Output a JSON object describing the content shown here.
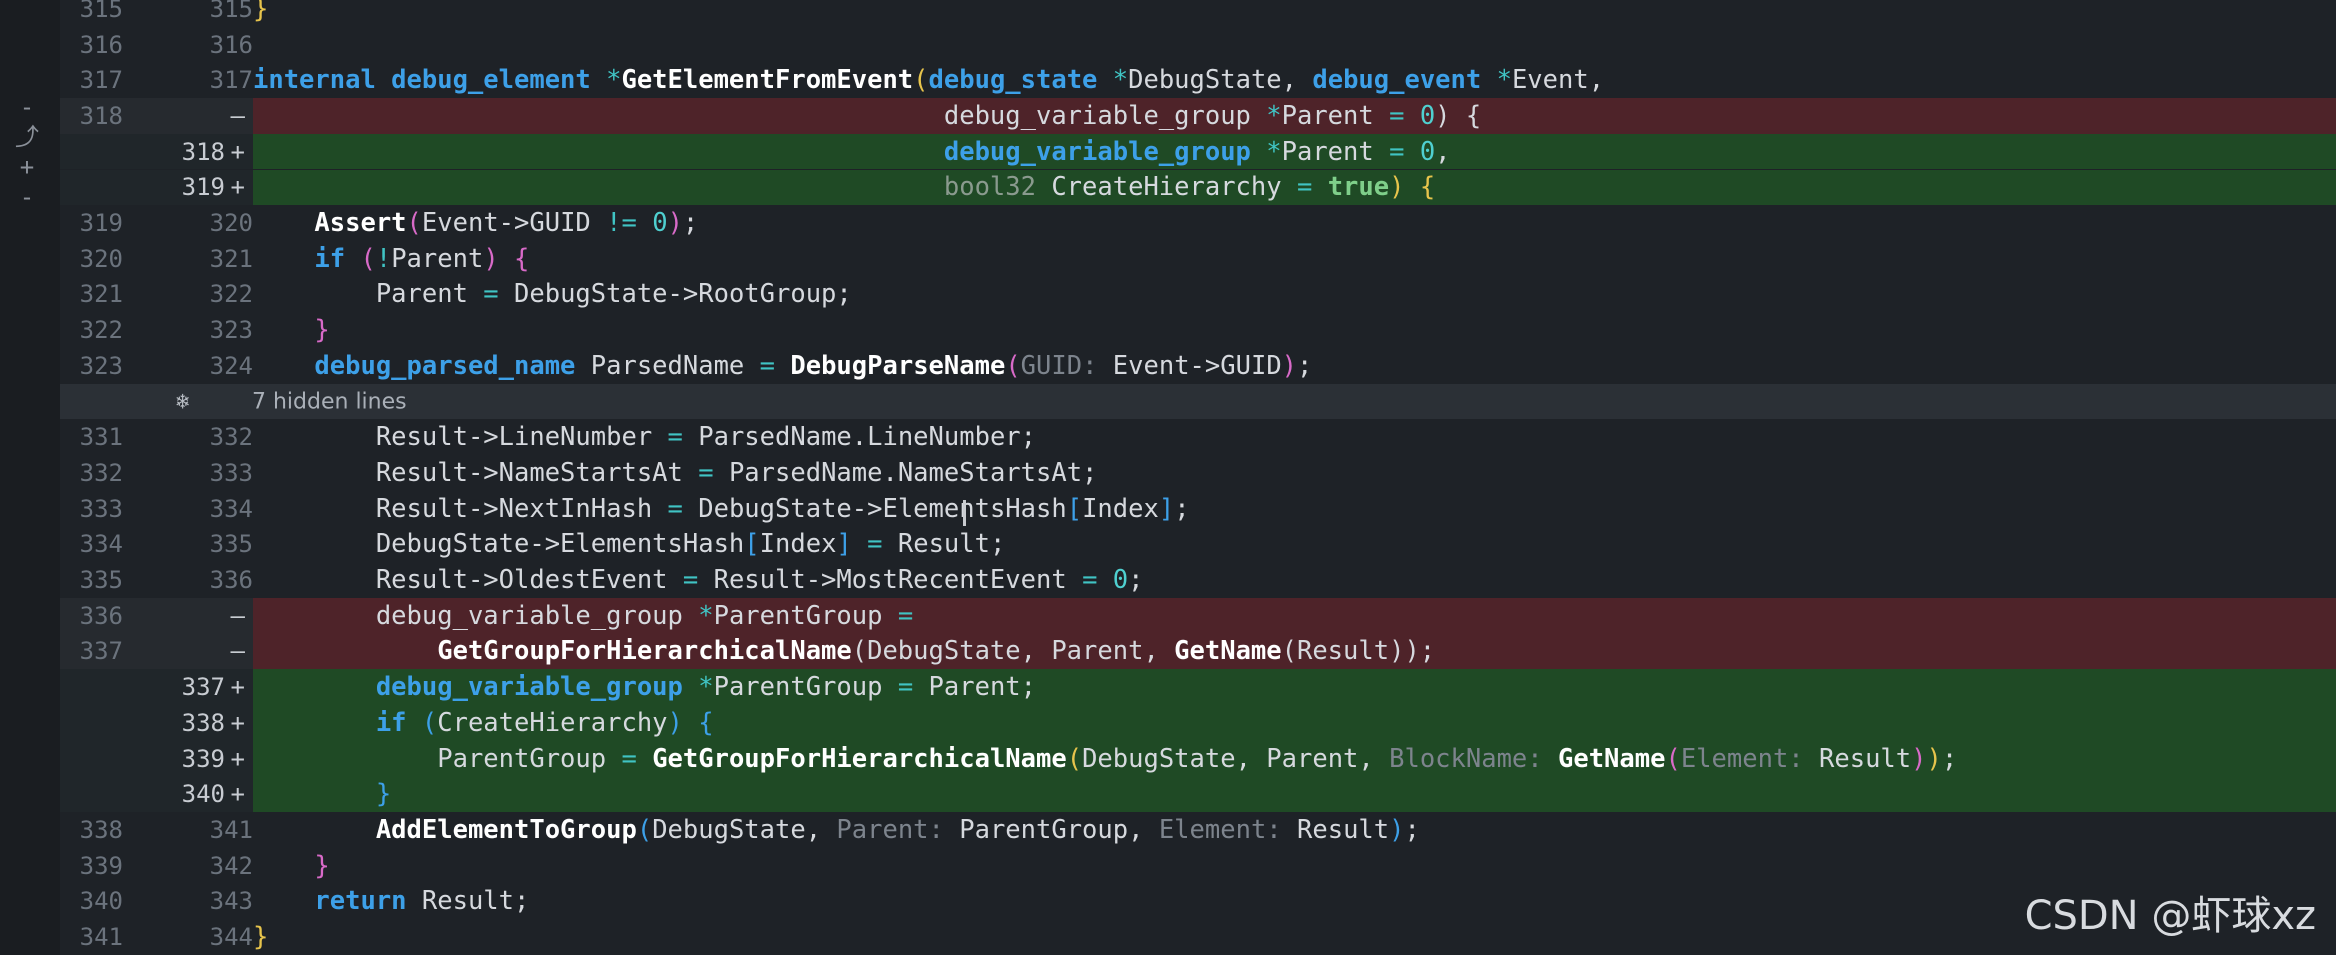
{
  "editor": {
    "fold_icon": "collapse-expand-icon",
    "fold_label": "7 hidden lines",
    "left_controls": [
      "collapse-icon",
      "undo-icon",
      "add-icon"
    ]
  },
  "watermark": "CSDN @虾球xz",
  "rows": [
    {
      "kind": "ctx",
      "old": "315",
      "new": "315",
      "tokens": [
        [
          "}",
          "t-b1"
        ]
      ]
    },
    {
      "kind": "ctx",
      "old": "316",
      "new": "316",
      "tokens": []
    },
    {
      "kind": "ctx",
      "old": "317",
      "new": "317",
      "tokens": [
        [
          "internal ",
          "t-kw"
        ],
        [
          "debug_element ",
          "t-ty"
        ],
        [
          "*",
          "t-op"
        ],
        [
          "GetElementFromEvent",
          "t-fn"
        ],
        [
          "(",
          "t-b1"
        ],
        [
          "debug_state ",
          "t-ty"
        ],
        [
          "*",
          "t-op"
        ],
        [
          "DebugState, ",
          "t-id"
        ],
        [
          "debug_event ",
          "t-ty"
        ],
        [
          "*",
          "t-op"
        ],
        [
          "Event,",
          "t-id"
        ]
      ]
    },
    {
      "kind": "del",
      "old": "318",
      "new": "",
      "mark": "—",
      "tokens": [
        [
          "                                             ",
          "t-id"
        ],
        [
          "debug_variable_group ",
          "t-id"
        ],
        [
          "*",
          "t-op"
        ],
        [
          "Parent ",
          "t-id"
        ],
        [
          "= ",
          "t-op"
        ],
        [
          "0",
          "t-num"
        ],
        [
          ") {",
          "t-id"
        ]
      ]
    },
    {
      "kind": "add",
      "old": "",
      "new": "318",
      "mark": "+",
      "tokens": [
        [
          "                                             ",
          "t-id"
        ],
        [
          "debug_variable_group ",
          "t-ty"
        ],
        [
          "*",
          "t-op"
        ],
        [
          "Parent ",
          "t-id"
        ],
        [
          "= ",
          "t-op"
        ],
        [
          "0",
          "t-num"
        ],
        [
          ",",
          "t-id"
        ]
      ]
    },
    {
      "kind": "add",
      "old": "",
      "new": "319",
      "mark": "+",
      "tokens": [
        [
          "                                             ",
          "t-id"
        ],
        [
          "bool32 ",
          "t-muted"
        ],
        [
          "CreateHierarchy ",
          "t-id"
        ],
        [
          "= ",
          "t-op"
        ],
        [
          "true",
          "t-true"
        ],
        [
          ") ",
          "t-b1"
        ],
        [
          "{",
          "t-b1"
        ]
      ]
    },
    {
      "kind": "ctx",
      "old": "319",
      "new": "320",
      "tokens": [
        [
          "    ",
          "t-id"
        ],
        [
          "Assert",
          "t-fn"
        ],
        [
          "(",
          "t-b2"
        ],
        [
          "Event->GUID ",
          "t-id"
        ],
        [
          "!= ",
          "t-op"
        ],
        [
          "0",
          "t-num"
        ],
        [
          ")",
          "t-b2"
        ],
        [
          ";",
          "t-id"
        ]
      ]
    },
    {
      "kind": "ctx",
      "old": "320",
      "new": "321",
      "tokens": [
        [
          "    ",
          "t-id"
        ],
        [
          "if ",
          "t-kw"
        ],
        [
          "(",
          "t-b2"
        ],
        [
          "!",
          "t-op"
        ],
        [
          "Parent",
          "t-id"
        ],
        [
          ") ",
          "t-b2"
        ],
        [
          "{",
          "t-b2"
        ]
      ]
    },
    {
      "kind": "ctx",
      "old": "321",
      "new": "322",
      "tokens": [
        [
          "        ",
          "t-id"
        ],
        [
          "Parent ",
          "t-id"
        ],
        [
          "= ",
          "t-op"
        ],
        [
          "DebugState->RootGroup;",
          "t-id"
        ]
      ]
    },
    {
      "kind": "ctx",
      "old": "322",
      "new": "323",
      "tokens": [
        [
          "    ",
          "t-id"
        ],
        [
          "}",
          "t-b2"
        ]
      ]
    },
    {
      "kind": "ctx",
      "old": "323",
      "new": "324",
      "tokens": [
        [
          "    ",
          "t-id"
        ],
        [
          "debug_parsed_name ",
          "t-ty"
        ],
        [
          "ParsedName ",
          "t-id"
        ],
        [
          "= ",
          "t-op"
        ],
        [
          "DebugParseName",
          "t-fn"
        ],
        [
          "(",
          "t-b2"
        ],
        [
          "GUID:",
          "t-hint"
        ],
        [
          " Event->GUID",
          "t-id"
        ],
        [
          ")",
          "t-b2"
        ],
        [
          ";",
          "t-id"
        ]
      ]
    },
    {
      "kind": "fold"
    },
    {
      "kind": "ctx",
      "old": "331",
      "new": "332",
      "tokens": [
        [
          "        ",
          "t-id"
        ],
        [
          "Result->LineNumber ",
          "t-id"
        ],
        [
          "= ",
          "t-op"
        ],
        [
          "ParsedName.LineNumber;",
          "t-id"
        ]
      ]
    },
    {
      "kind": "ctx",
      "old": "332",
      "new": "333",
      "tokens": [
        [
          "        ",
          "t-id"
        ],
        [
          "Result->NameStartsAt ",
          "t-id"
        ],
        [
          "= ",
          "t-op"
        ],
        [
          "ParsedName.NameStartsAt;",
          "t-id"
        ]
      ]
    },
    {
      "kind": "ctx",
      "old": "333",
      "new": "334",
      "tokens": [
        [
          "        ",
          "t-id"
        ],
        [
          "Result->NextInHash ",
          "t-id"
        ],
        [
          "= ",
          "t-op"
        ],
        [
          "DebugState->ElementsHash",
          "t-id"
        ],
        [
          "[",
          "t-b3"
        ],
        [
          "Index",
          "t-id"
        ],
        [
          "]",
          "t-b3"
        ],
        [
          ";",
          "t-id"
        ]
      ]
    },
    {
      "kind": "ctx",
      "old": "334",
      "new": "335",
      "tokens": [
        [
          "        ",
          "t-id"
        ],
        [
          "DebugState->ElementsHash",
          "t-id"
        ],
        [
          "[",
          "t-b3"
        ],
        [
          "Index",
          "t-id"
        ],
        [
          "] ",
          "t-b3"
        ],
        [
          "= ",
          "t-op"
        ],
        [
          "Result;",
          "t-id"
        ]
      ]
    },
    {
      "kind": "ctx",
      "old": "335",
      "new": "336",
      "tokens": [
        [
          "        ",
          "t-id"
        ],
        [
          "Result->OldestEvent ",
          "t-id"
        ],
        [
          "= ",
          "t-op"
        ],
        [
          "Result->MostRecentEvent ",
          "t-id"
        ],
        [
          "= ",
          "t-op"
        ],
        [
          "0",
          "t-num"
        ],
        [
          ";",
          "t-id"
        ]
      ]
    },
    {
      "kind": "del",
      "old": "336",
      "new": "",
      "mark": "—",
      "tokens": [
        [
          "        ",
          "t-id"
        ],
        [
          "debug_variable_group ",
          "t-id"
        ],
        [
          "*",
          "t-op"
        ],
        [
          "ParentGroup ",
          "t-id"
        ],
        [
          "=",
          "t-op"
        ]
      ]
    },
    {
      "kind": "del",
      "old": "337",
      "new": "",
      "mark": "—",
      "tokens": [
        [
          "            ",
          "t-id"
        ],
        [
          "GetGroupForHierarchicalName",
          "t-fn"
        ],
        [
          "(DebugState, Parent, ",
          "t-id"
        ],
        [
          "GetName",
          "t-fn"
        ],
        [
          "(Result));",
          "t-id"
        ]
      ]
    },
    {
      "kind": "add",
      "old": "",
      "new": "337",
      "mark": "+",
      "tokens": [
        [
          "        ",
          "t-id"
        ],
        [
          "debug_variable_group ",
          "t-ty"
        ],
        [
          "*",
          "t-op"
        ],
        [
          "ParentGroup ",
          "t-id"
        ],
        [
          "= ",
          "t-op"
        ],
        [
          "Parent;",
          "t-id"
        ]
      ]
    },
    {
      "kind": "add",
      "old": "",
      "new": "338",
      "mark": "+",
      "tokens": [
        [
          "        ",
          "t-id"
        ],
        [
          "if ",
          "t-kw"
        ],
        [
          "(",
          "t-b3"
        ],
        [
          "CreateHierarchy",
          "t-id"
        ],
        [
          ") ",
          "t-b3"
        ],
        [
          "{",
          "t-b3"
        ]
      ]
    },
    {
      "kind": "add",
      "old": "",
      "new": "339",
      "mark": "+",
      "tokens": [
        [
          "            ",
          "t-id"
        ],
        [
          "ParentGroup ",
          "t-id"
        ],
        [
          "= ",
          "t-op"
        ],
        [
          "GetGroupForHierarchicalName",
          "t-fn"
        ],
        [
          "(",
          "t-b1"
        ],
        [
          "DebugState, Parent, ",
          "t-id"
        ],
        [
          "BlockName:",
          "t-hint"
        ],
        [
          " ",
          "t-id"
        ],
        [
          "GetName",
          "t-fn"
        ],
        [
          "(",
          "t-b2"
        ],
        [
          "Element:",
          "t-hint"
        ],
        [
          " Result",
          "t-id"
        ],
        [
          ")",
          "t-b2"
        ],
        [
          ")",
          "t-b1"
        ],
        [
          ";",
          "t-id"
        ]
      ]
    },
    {
      "kind": "add",
      "old": "",
      "new": "340",
      "mark": "+",
      "tokens": [
        [
          "        ",
          "t-id"
        ],
        [
          "}",
          "t-b3"
        ]
      ]
    },
    {
      "kind": "ctx",
      "old": "338",
      "new": "341",
      "tokens": [
        [
          "        ",
          "t-id"
        ],
        [
          "AddElementToGroup",
          "t-fn"
        ],
        [
          "(",
          "t-b3"
        ],
        [
          "DebugState, ",
          "t-id"
        ],
        [
          "Parent:",
          "t-hint"
        ],
        [
          " ParentGroup, ",
          "t-id"
        ],
        [
          "Element:",
          "t-hint"
        ],
        [
          " Result",
          "t-id"
        ],
        [
          ")",
          "t-b3"
        ],
        [
          ";",
          "t-id"
        ]
      ]
    },
    {
      "kind": "ctx",
      "old": "339",
      "new": "342",
      "tokens": [
        [
          "    ",
          "t-id"
        ],
        [
          "}",
          "t-b2"
        ]
      ]
    },
    {
      "kind": "ctx",
      "old": "340",
      "new": "343",
      "tokens": [
        [
          "    ",
          "t-id"
        ],
        [
          "return ",
          "t-kw"
        ],
        [
          "Result;",
          "t-id"
        ]
      ]
    },
    {
      "kind": "ctx",
      "old": "341",
      "new": "344",
      "tokens": [
        [
          "}",
          "t-b1"
        ]
      ]
    }
  ]
}
